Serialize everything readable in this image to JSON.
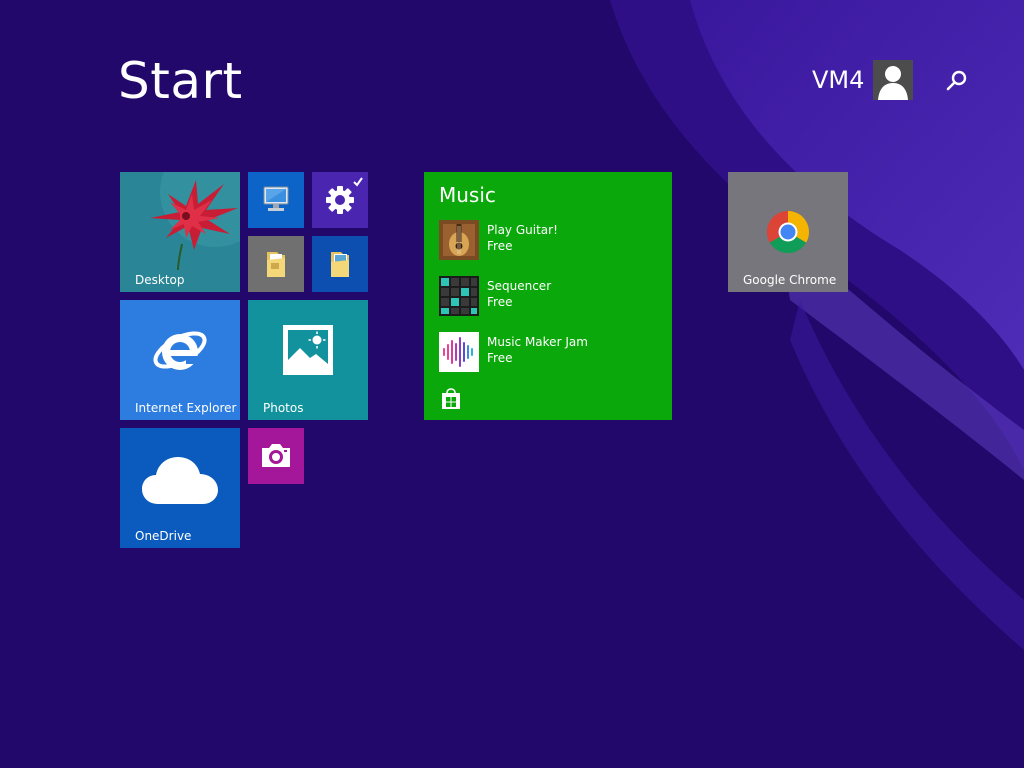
{
  "start": {
    "title": "Start"
  },
  "user": {
    "name": "VM4"
  },
  "tiles": {
    "desktop": {
      "label": "Desktop"
    },
    "internet_explorer": {
      "label": "Internet Explorer"
    },
    "photos": {
      "label": "Photos"
    },
    "onedrive": {
      "label": "OneDrive"
    },
    "google_chrome": {
      "label": "Google Chrome"
    }
  },
  "music": {
    "title": "Music",
    "apps": [
      {
        "name": "Play Guitar!",
        "price": "Free"
      },
      {
        "name": "Sequencer",
        "price": "Free"
      },
      {
        "name": "Music Maker Jam",
        "price": "Free"
      }
    ]
  },
  "colors": {
    "background": "#22086a",
    "ie": "#2d7de0",
    "photos": "#12929c",
    "onedrive": "#0a5bbd",
    "music": "#0aa80a",
    "chrome": "#76767c",
    "settings": "#4a25b0",
    "camera": "#a5179a"
  }
}
